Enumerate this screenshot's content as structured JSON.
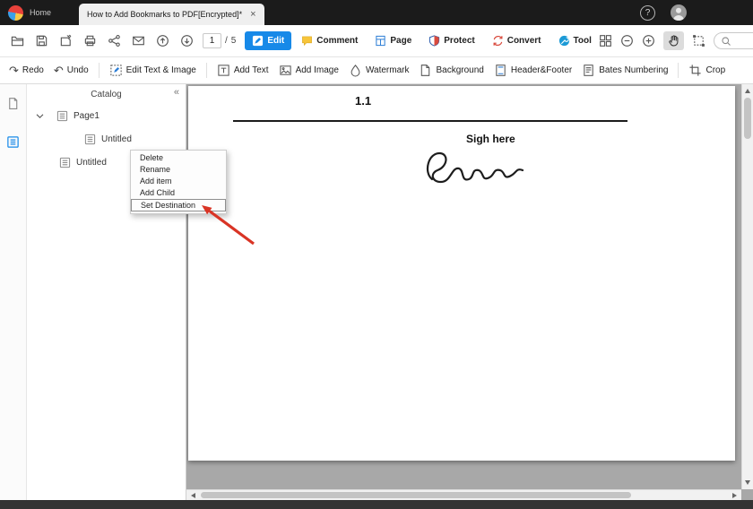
{
  "titlebar": {
    "home_label": "Home",
    "tab_title": "How to Add Bookmarks to PDF[Encrypted]*",
    "tab_close": "×",
    "help": "?"
  },
  "toolbar": {
    "page_current": "1",
    "page_sep": "/",
    "page_total": "5",
    "modes": [
      {
        "label": "Edit"
      },
      {
        "label": "Comment"
      },
      {
        "label": "Page"
      },
      {
        "label": "Protect"
      },
      {
        "label": "Convert"
      },
      {
        "label": "Tool"
      }
    ],
    "search_value": ""
  },
  "icons": {
    "redo_glyph": "↷",
    "undo_glyph": "↶"
  },
  "actions": {
    "redo": "Redo",
    "undo": "Undo",
    "edit_text_image": "Edit Text & Image",
    "add_text": "Add Text",
    "add_image": "Add Image",
    "watermark": "Watermark",
    "background": "Background",
    "header_footer": "Header&Footer",
    "bates": "Bates Numbering",
    "crop": "Crop"
  },
  "catalog": {
    "title": "Catalog",
    "collapse": "«",
    "items": [
      {
        "label": "Page1"
      },
      {
        "label": "Untitled"
      },
      {
        "label": "Untitled"
      }
    ]
  },
  "context_menu": {
    "items": [
      {
        "label": "Delete"
      },
      {
        "label": "Rename"
      },
      {
        "label": "Add item"
      },
      {
        "label": "Add Child"
      },
      {
        "label": "Set Destination"
      }
    ]
  },
  "page": {
    "heading": "1.1",
    "sign_label": "Sigh here"
  },
  "colors": {
    "accent_blue": "#1789e8",
    "annotation_red": "#d93425"
  }
}
